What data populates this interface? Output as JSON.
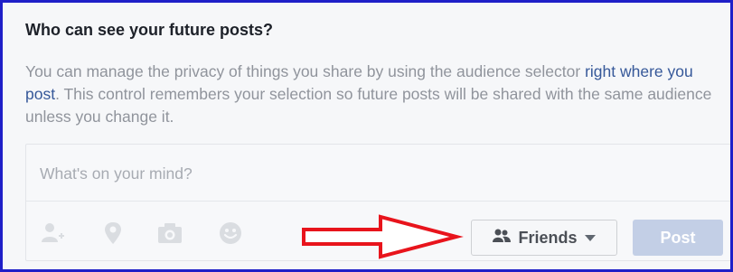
{
  "header": {
    "title": "Who can see your future posts?"
  },
  "description": {
    "part1": "You can manage the privacy of things you share by using the audience selector ",
    "link_text": "right where you post",
    "part2": ". This control remembers your selection so future posts will be shared with the same audience unless you change it."
  },
  "composer": {
    "placeholder": "What's on your mind?",
    "tools": [
      "tag-friends-icon",
      "location-icon",
      "camera-icon",
      "feeling-icon"
    ],
    "audience_label": "Friends",
    "post_label": "Post"
  },
  "colors": {
    "frame_border": "#1f1fc8",
    "annotation_arrow": "#e8141c",
    "link": "#365899",
    "post_button_disabled": "#c3cfe6"
  }
}
